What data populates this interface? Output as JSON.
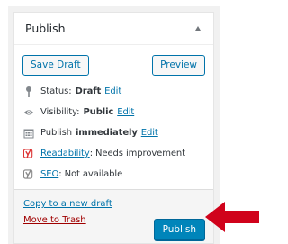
{
  "panel": {
    "title": "Publish",
    "save_draft_label": "Save Draft",
    "preview_label": "Preview"
  },
  "status": {
    "label": "Status:",
    "value": "Draft",
    "edit": "Edit"
  },
  "visibility": {
    "label": "Visibility:",
    "value": "Public",
    "edit": "Edit"
  },
  "schedule": {
    "label": "Publish",
    "value": "immediately",
    "edit": "Edit"
  },
  "readability": {
    "link": "Readability",
    "text": ": Needs improvement",
    "icon_color": "#dc3232"
  },
  "seo": {
    "link": "SEO",
    "text": ": Not available",
    "icon_color": "#888888"
  },
  "footer": {
    "copy_link": "Copy to a new draft",
    "trash_link": "Move to Trash",
    "publish_label": "Publish"
  },
  "colors": {
    "accent": "#0073aa",
    "primary_button": "#0085ba",
    "trash": "#a00000",
    "arrow": "#d0021b"
  },
  "icons": {
    "toggle": "triangle-up-icon",
    "status": "pin-icon",
    "visibility": "eye-icon",
    "schedule": "calendar-icon",
    "readability": "yoast-icon",
    "seo": "yoast-icon",
    "annotation": "red-arrow-icon"
  }
}
